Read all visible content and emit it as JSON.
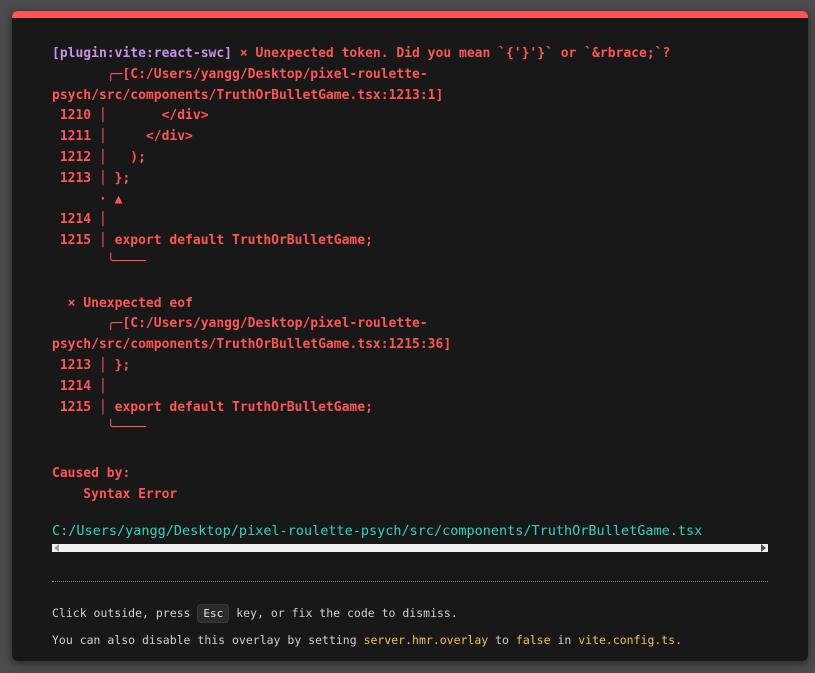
{
  "error": {
    "plugin": "[plugin:vite:react-swc]",
    "message": " × Unexpected token. Did you mean `{'}'}` or `&rbrace;`?",
    "frame": "       ╭─[C:/Users/yangg/Desktop/pixel-roulette-\npsych/src/components/TruthOrBulletGame.tsx:1213:1]\n 1210 │       </div>\n 1211 │     </div>\n 1212 │   );\n 1213 │ };\n      · ▲\n 1214 │\n 1215 │ export default TruthOrBulletGame;\n       ╰────\n\n  × Unexpected eof\n       ╭─[C:/Users/yangg/Desktop/pixel-roulette-\npsych/src/components/TruthOrBulletGame.tsx:1215:36]\n 1213 │ };\n 1214 │\n 1215 │ export default TruthOrBulletGame;\n       ╰────",
    "caused_by": "Caused by:\n    Syntax Error",
    "file": "C:/Users/yangg/Desktop/pixel-roulette-psych/src/components/TruthOrBulletGame.tsx"
  },
  "tip": {
    "line1_before": "Click outside, press ",
    "line1_key": "Esc",
    "line1_after": " key, or fix the code to dismiss.",
    "line2_a": "You can also disable this overlay by setting ",
    "line2_setting": "server.hmr.overlay",
    "line2_b": " to ",
    "line2_value": "false",
    "line2_c": " in ",
    "line2_config": "vite.config.ts",
    "line2_d": "."
  },
  "colors": {
    "accent_red": "#ff5555",
    "plugin_purple": "#c792ea",
    "file_cyan": "#2dd4bf",
    "code_yellow": "#f4c152"
  }
}
